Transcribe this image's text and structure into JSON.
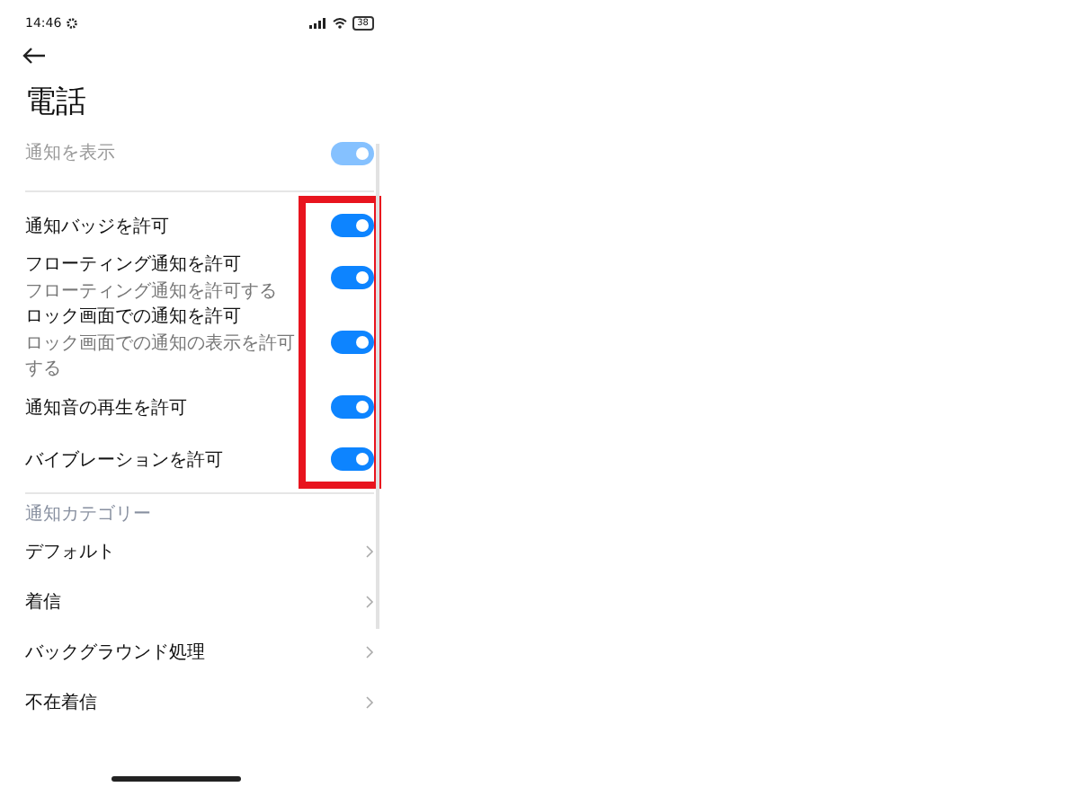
{
  "status_bar": {
    "time": "14:46",
    "battery": "38"
  },
  "title": "電話",
  "show_notifications": {
    "label": "通知を表示",
    "on": true,
    "disabled": true
  },
  "toggles": [
    {
      "label": "通知バッジを許可",
      "on": true
    },
    {
      "label": "フローティング通知を許可",
      "subtitle": "フローティング通知を許可する",
      "on": true
    },
    {
      "label": "ロック画面での通知を許可",
      "subtitle": "ロック画面での通知の表示を許可する",
      "on": true
    },
    {
      "label": "通知音の再生を許可",
      "on": true
    },
    {
      "label": "バイブレーションを許可",
      "on": true
    }
  ],
  "category_header": "通知カテゴリー",
  "categories": [
    {
      "label": "デフォルト"
    },
    {
      "label": "着信"
    },
    {
      "label": "バックグラウンド処理"
    },
    {
      "label": "不在着信"
    }
  ]
}
